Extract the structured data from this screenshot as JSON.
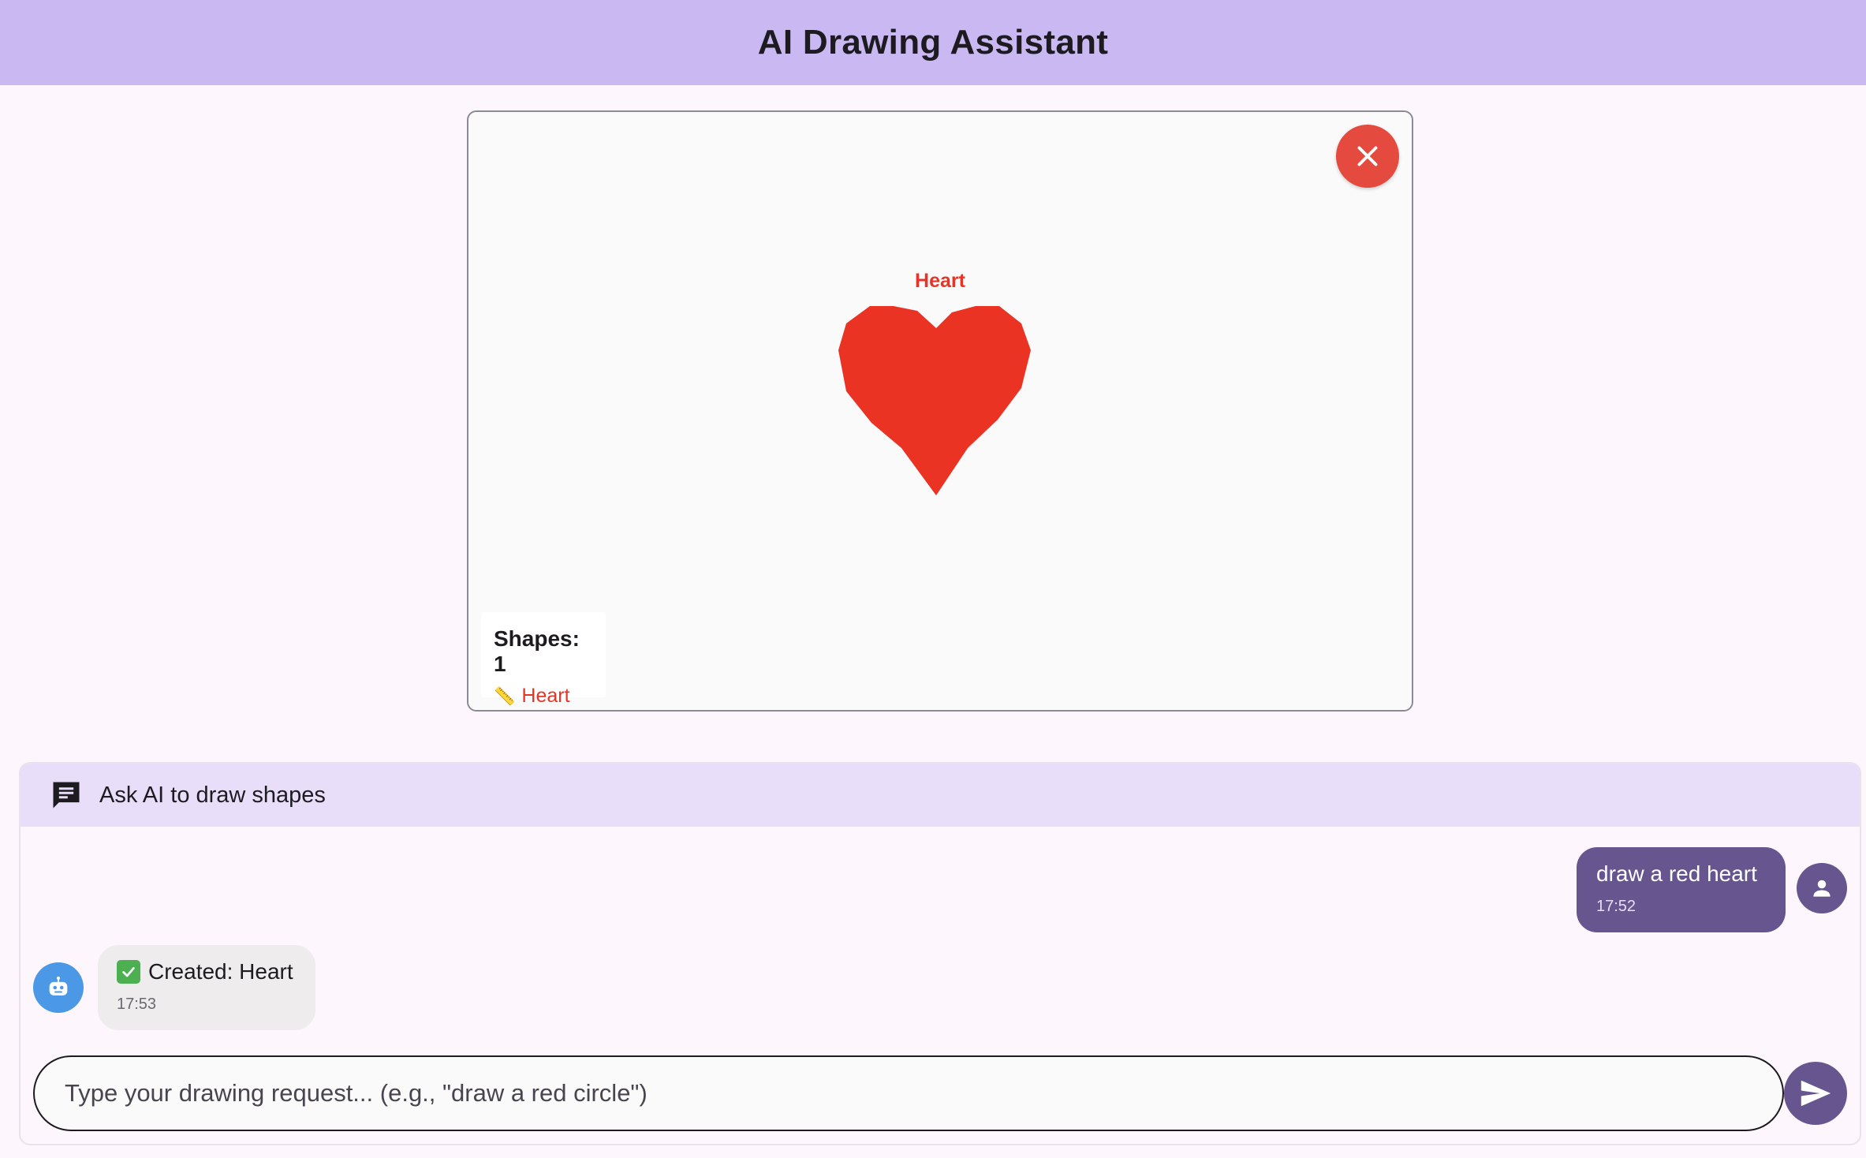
{
  "app": {
    "title": "AI Drawing Assistant"
  },
  "canvas": {
    "shape_label": "Heart",
    "shape_color": "#e53528",
    "shapes_count_label": "Shapes: 1",
    "shapes_list": [
      {
        "icon": "ruler-icon",
        "label": "Heart"
      }
    ],
    "clear_button_icon": "close-icon",
    "clear_button_color": "#e44a3d"
  },
  "chat": {
    "header_icon": "chat-icon",
    "header_title": "Ask AI to draw shapes",
    "messages": [
      {
        "role": "user",
        "text": "draw a red heart",
        "time": "17:52",
        "avatar_icon": "person-icon"
      },
      {
        "role": "bot",
        "icon": "check-icon",
        "text": "Created: Heart",
        "time": "17:53",
        "avatar_icon": "robot-icon"
      }
    ],
    "input": {
      "placeholder": "Type your drawing request... (e.g., \"draw a red circle\")",
      "value": ""
    },
    "send_button_icon": "send-icon"
  },
  "colors": {
    "appbar": "#c9b8f2",
    "accent": "#66558e",
    "bot_avatar": "#4a98e6"
  }
}
